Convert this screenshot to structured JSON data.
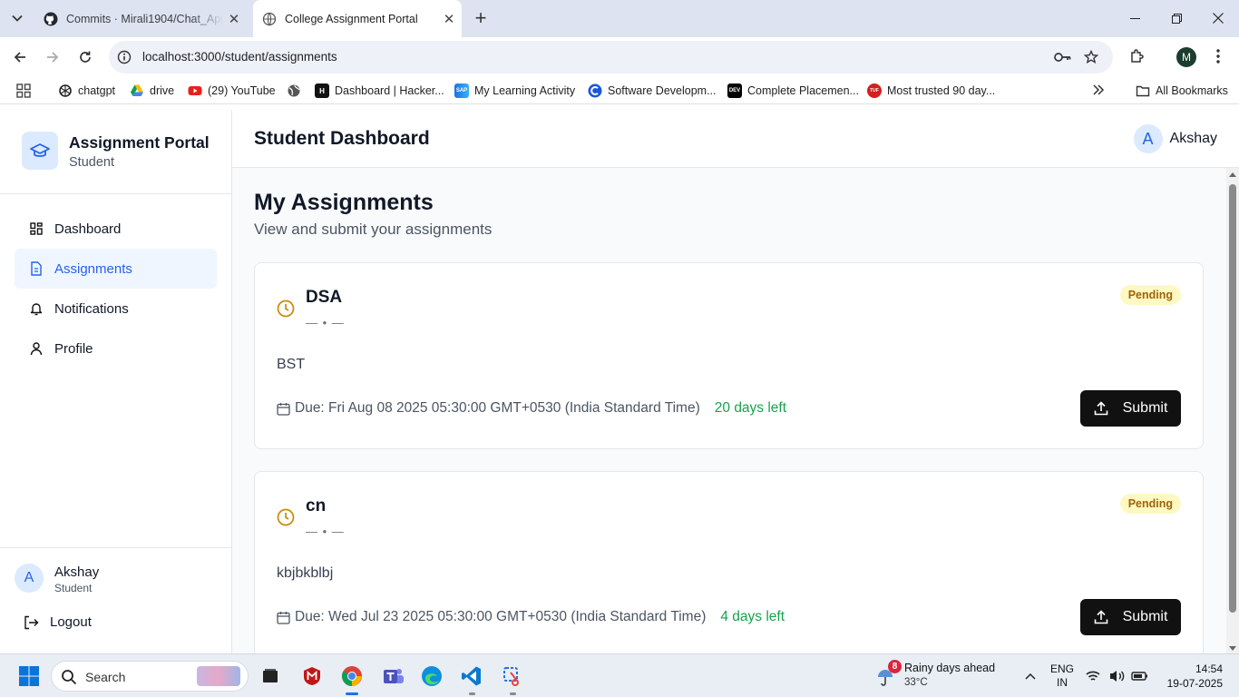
{
  "browser": {
    "tabs": [
      {
        "title": "Commits · Mirali1904/Chat_App",
        "icon": "github-icon"
      },
      {
        "title": "College Assignment Portal",
        "icon": "globe-icon"
      }
    ],
    "url": "localhost:3000/student/assignments",
    "profile_initial": "M",
    "bookmarks": [
      {
        "label": "chatgpt",
        "icon": "openai-icon"
      },
      {
        "label": "drive",
        "icon": "drive-icon"
      },
      {
        "label": "(29) YouTube",
        "icon": "youtube-icon"
      },
      {
        "label": "",
        "icon": "globe-icon"
      },
      {
        "label": "Dashboard | Hacker...",
        "icon": "hackerrank-icon"
      },
      {
        "label": "My Learning Activity",
        "icon": "sap-icon"
      },
      {
        "label": "Software Developm...",
        "icon": "c-logo-icon"
      },
      {
        "label": "Complete Placemen...",
        "icon": "dev-icon"
      },
      {
        "label": "Most trusted 90 day...",
        "icon": "tuf-icon"
      }
    ],
    "all_bookmarks": "All Bookmarks"
  },
  "sidebar": {
    "brand_title": "Assignment Portal",
    "brand_subtitle": "Student",
    "items": [
      {
        "label": "Dashboard",
        "icon": "grid-icon"
      },
      {
        "label": "Assignments",
        "icon": "file-icon"
      },
      {
        "label": "Notifications",
        "icon": "bell-icon"
      },
      {
        "label": "Profile",
        "icon": "user-icon"
      }
    ],
    "active_item": "Assignments",
    "user": {
      "initial": "A",
      "name": "Akshay",
      "role": "Student"
    },
    "logout": "Logout"
  },
  "header": {
    "title": "Student Dashboard",
    "user_initial": "A",
    "user_name": "Akshay"
  },
  "main": {
    "title": "My Assignments",
    "subtitle": "View and submit your assignments",
    "assignments": [
      {
        "title": "DSA",
        "meta": "— • —",
        "description": "BST",
        "due": "Due: Fri Aug 08 2025 05:30:00 GMT+0530 (India Standard Time)",
        "days_left": "20 days left",
        "status": "Pending",
        "submit_label": "Submit"
      },
      {
        "title": "cn",
        "meta": "— • —",
        "description": "kbjbkblbj",
        "due": "Due: Wed Jul 23 2025 05:30:00 GMT+0530 (India Standard Time)",
        "days_left": "4 days left",
        "status": "Pending",
        "submit_label": "Submit"
      }
    ]
  },
  "taskbar": {
    "search_placeholder": "Search",
    "weather_badge": "8",
    "weather_title": "Rainy days ahead",
    "weather_temp": "33°C",
    "lang_line1": "ENG",
    "lang_line2": "IN",
    "time": "14:54",
    "date": "19-07-2025"
  },
  "colors": {
    "accent": "#2563eb",
    "active_bg": "#eff6ff",
    "pending_bg": "#fef9c3",
    "pending_text": "#a16207",
    "days_left": "#16a34a",
    "clock_icon": "#ca8a04",
    "submit_bg": "#111111"
  }
}
